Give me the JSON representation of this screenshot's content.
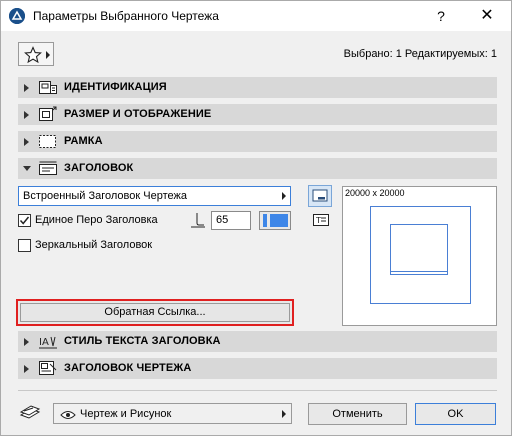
{
  "window": {
    "title": "Параметры Выбранного Чертежа",
    "help_label": "?",
    "close_label": "✕"
  },
  "header": {
    "favorites_icon": "star-icon",
    "selection_info": "Выбрано: 1 Редактируемых: 1"
  },
  "sections": [
    {
      "label": "ИДЕНТИФИКАЦИЯ",
      "expanded": false,
      "icon": "identification-icon"
    },
    {
      "label": "РАЗМЕР И ОТОБРАЖЕНИЕ",
      "expanded": false,
      "icon": "size-display-icon"
    },
    {
      "label": "РАМКА",
      "expanded": false,
      "icon": "frame-icon"
    },
    {
      "label": "ЗАГОЛОВОК",
      "expanded": true,
      "icon": "title-icon"
    },
    {
      "label": "СТИЛЬ ТЕКСТА ЗАГОЛОВКА",
      "expanded": false,
      "icon": "title-text-style-icon"
    },
    {
      "label": "ЗАГОЛОВОК ЧЕРТЕЖА",
      "expanded": false,
      "icon": "drawing-title-icon"
    }
  ],
  "title_panel": {
    "title_type": "Встроенный Заголовок Чертежа",
    "uniform_pen_label": "Единое Перо Заголовка",
    "uniform_pen_checked": true,
    "pen_value": "65",
    "pen_color": "#3d86e8",
    "mirrored_label": "Зеркальный Заголовок",
    "mirrored_checked": false,
    "preview_dims": "20000 x 20000",
    "back_link_label": "Обратная Ссылка..."
  },
  "footer": {
    "layer_value": "Чертеж и Рисунок",
    "cancel_label": "Отменить",
    "ok_label": "OK"
  },
  "colors": {
    "accent": "#3c7fd9",
    "highlight": "#e02020",
    "section_bg": "#d8d8d8"
  }
}
